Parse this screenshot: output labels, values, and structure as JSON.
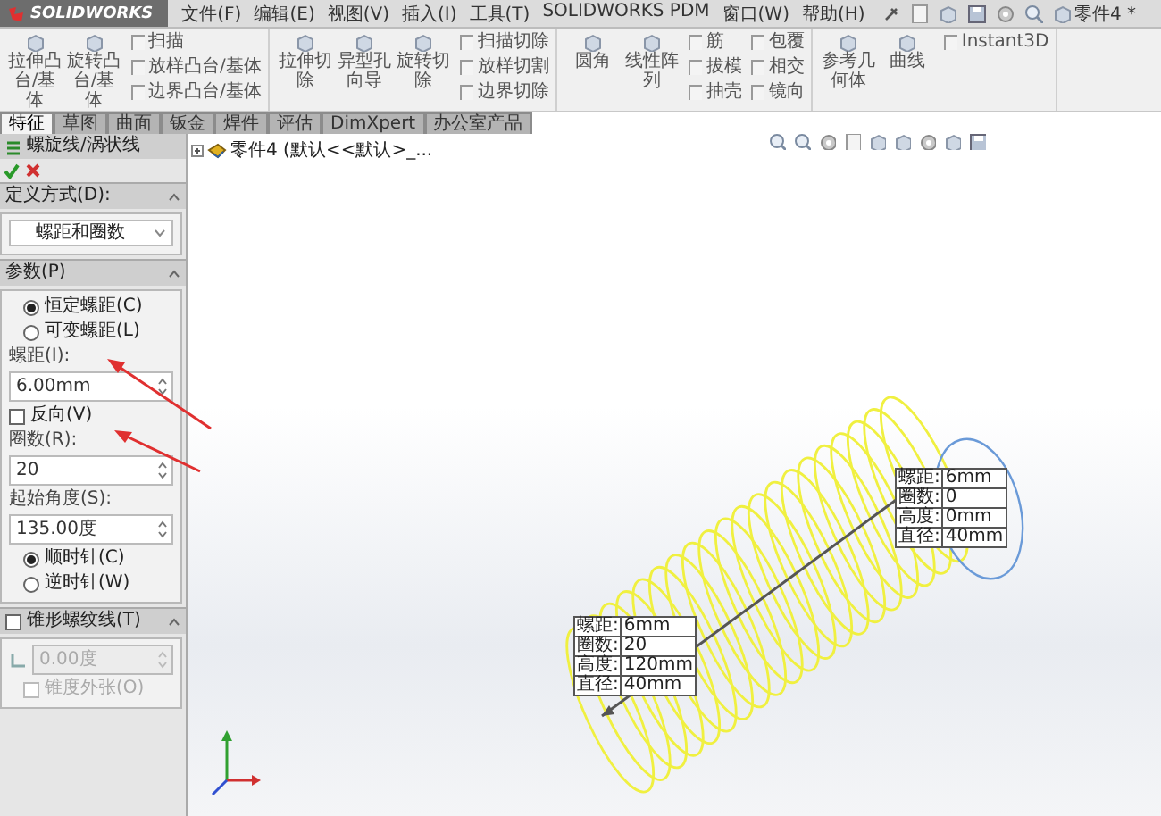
{
  "window": {
    "logo": "SOLIDWORKS",
    "title": "零件4 *"
  },
  "menu": [
    "文件(F)",
    "编辑(E)",
    "视图(V)",
    "插入(I)",
    "工具(T)",
    "SOLIDWORKS PDM",
    "窗口(W)",
    "帮助(H)"
  ],
  "ribbon": {
    "groups": [
      {
        "large": [
          "拉伸凸台/基体",
          "旋转凸台/基体"
        ],
        "columns": [
          [
            "扫描",
            "放样凸台/基体",
            "边界凸台/基体"
          ]
        ]
      },
      {
        "large": [
          "拉伸切除",
          "异型孔向导",
          "旋转切除"
        ],
        "columns": [
          [
            "扫描切除",
            "放样切割",
            "边界切除"
          ]
        ]
      },
      {
        "large": [
          "圆角",
          "线性阵列"
        ],
        "columns": [
          [
            "筋",
            "拔模",
            "抽壳"
          ],
          [
            "包覆",
            "相交",
            "镜向"
          ]
        ]
      },
      {
        "large": [
          "参考几何体",
          "曲线"
        ],
        "columns": [
          [
            "Instant3D"
          ]
        ]
      }
    ]
  },
  "tabs": [
    {
      "label": "特征",
      "selected": true
    },
    {
      "label": "草图",
      "selected": false
    },
    {
      "label": "曲面",
      "selected": false
    },
    {
      "label": "钣金",
      "selected": false
    },
    {
      "label": "焊件",
      "selected": false
    },
    {
      "label": "评估",
      "selected": false
    },
    {
      "label": "DimXpert",
      "selected": false
    },
    {
      "label": "办公室产品",
      "selected": false
    }
  ],
  "panel": {
    "title": "螺旋线/涡状线",
    "definition": {
      "heading": "定义方式(D):",
      "value": "螺距和圈数"
    },
    "parameters": {
      "heading": "参数(P)",
      "modes": [
        {
          "label": "恒定螺距(C)",
          "selected": true
        },
        {
          "label": "可变螺距(L)",
          "selected": false
        }
      ],
      "pitch": {
        "label": "螺距(I):",
        "value": "6.00mm"
      },
      "reverse": {
        "label": "反向(V)",
        "checked": false
      },
      "revolutions": {
        "label": "圈数(R):",
        "value": "20"
      },
      "start_angle": {
        "label": "起始角度(S):",
        "value": "135.00度"
      },
      "directions": [
        {
          "label": "顺时针(C)",
          "selected": true
        },
        {
          "label": "逆时针(W)",
          "selected": false
        }
      ]
    },
    "taper": {
      "heading": "锥形螺纹线(T)",
      "checked": false,
      "angle": {
        "value": "0.00度",
        "disabled": true
      },
      "outward": {
        "label": "锥度外张(O)",
        "checked": false,
        "disabled": true
      }
    }
  },
  "feature_tree": {
    "item": "零件4 (默认<<默认>_..."
  },
  "callouts": [
    {
      "rows": [
        {
          "label": "螺距:",
          "value": "6mm"
        },
        {
          "label": "圈数:",
          "value": "0"
        },
        {
          "label": "高度:",
          "value": "0mm"
        },
        {
          "label": "直径:",
          "value": "40mm"
        }
      ]
    },
    {
      "rows": [
        {
          "label": "螺距:",
          "value": "6mm"
        },
        {
          "label": "圈数:",
          "value": "20"
        },
        {
          "label": "高度:",
          "value": "120mm"
        },
        {
          "label": "直径:",
          "value": "40mm"
        }
      ]
    }
  ]
}
